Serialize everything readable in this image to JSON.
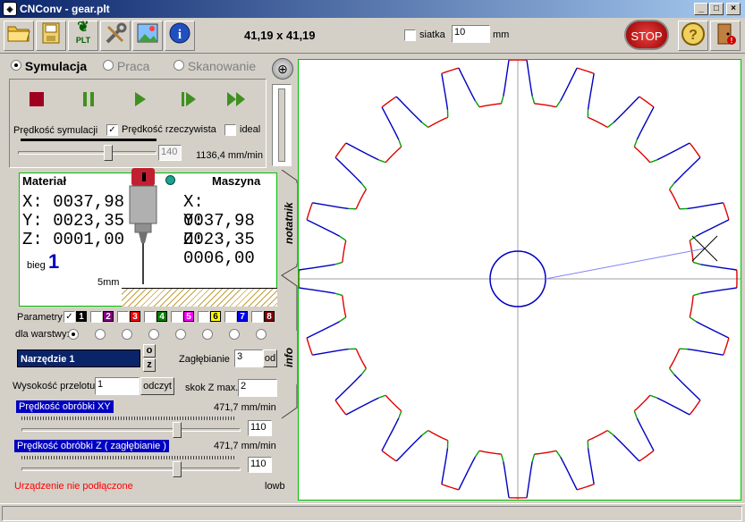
{
  "window": {
    "title": "CNConv - gear.plt"
  },
  "toolbar": {
    "dims": "41,19 x 41,19",
    "grid_label": "siatka",
    "grid_value": "10",
    "grid_unit": "mm",
    "stop_label": "STOP",
    "plt_label": "PLT"
  },
  "modes": {
    "sim": "Symulacja",
    "work": "Praca",
    "scan": "Skanowanie"
  },
  "sim": {
    "speed_label": "Prędkość symulacji",
    "real_speed_label": "Prędkość rzeczywista",
    "ideal_label": "ideal",
    "speed_value": "140",
    "speed_mm": "1136,4 mm/min",
    "slider_pos": 0.66
  },
  "coords": {
    "material_title": "Materiał",
    "machine_title": "Maszyna",
    "mx": "X:  0037,98",
    "my": "Y:  0023,35",
    "mz": "Z:  0001,00",
    "sx": "X:  0037,98",
    "sy": "Y:  0023,35",
    "sz": "Z:  0006,00",
    "gear_label": "bieg",
    "gear_value": "1",
    "scale": "5mm"
  },
  "tabs": {
    "notes": "notatnik",
    "info": "info"
  },
  "layers": {
    "label": "Parametry",
    "for_layer_label": "dla warstwy:",
    "items": [
      {
        "num": "1",
        "color": "#000000"
      },
      {
        "num": "2",
        "color": "#800080"
      },
      {
        "num": "3",
        "color": "#ff0000"
      },
      {
        "num": "4",
        "color": "#008000"
      },
      {
        "num": "5",
        "color": "#ff00ff"
      },
      {
        "num": "6",
        "color": "#ffff00"
      },
      {
        "num": "7",
        "color": "#0000ff"
      },
      {
        "num": "8",
        "color": "#800000"
      }
    ]
  },
  "tool": {
    "name": "Narzędzie 1",
    "btn_o": "o",
    "btn_z": "z",
    "depth_label": "Zagłębianie",
    "depth_value": "3",
    "depth_btn": "od",
    "lift_label": "Wysokość przelotu",
    "lift_value": "1",
    "read_btn": "odczyt",
    "zstep_label": "skok Z max.",
    "zstep_value": "2"
  },
  "speeds": {
    "xy_label": "Prędkość obróbki  XY",
    "xy_value": "471,7 mm/min",
    "xy_box": "110",
    "xy_pos": 0.72,
    "z_label": "Prędkość obróbki  Z  ( zagłębianie )",
    "z_value": "471,7 mm/min",
    "z_box": "110",
    "z_pos": 0.72
  },
  "status": {
    "device": "Urządzenie nie podłączone",
    "right": "lowb"
  },
  "colors": {
    "accent": "#0000c0",
    "status_error": "#ff0000",
    "canvas_border": "#00c000"
  }
}
